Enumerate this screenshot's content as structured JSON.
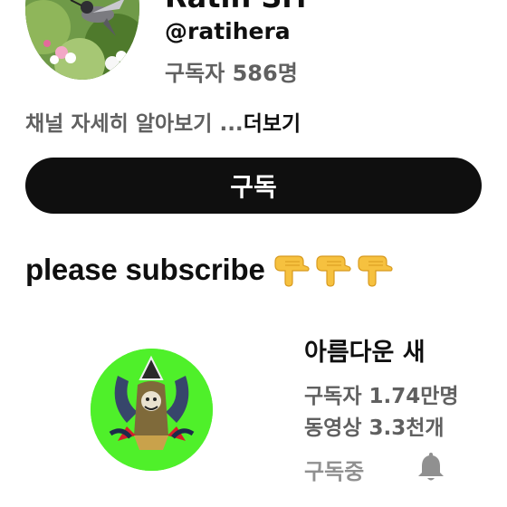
{
  "channel": {
    "name": "Ratih Sri",
    "handle": "@ratihera",
    "subscribers": "구독자 586명",
    "description": "채널 자세히 알아보기 ...",
    "more_label": "더보기",
    "subscribe_label": "구독"
  },
  "promo": {
    "text": "please subscribe",
    "emoji_icons": [
      "backhand-index-pointing-down-icon",
      "backhand-index-pointing-down-icon",
      "backhand-index-pointing-down-icon"
    ]
  },
  "featured_channel": {
    "name": "아름다운 새",
    "subscribers": "구독자 1.74만명",
    "videos": "동영상 3.3천개",
    "subscribed_label": "구독중",
    "avatar_color": "#4ff02a",
    "notification_icon": "bell-icon"
  },
  "colors": {
    "primary_text": "#0f0f0f",
    "secondary_text": "#606060",
    "button_bg": "#0f0f0f",
    "disabled_text": "#909090"
  }
}
